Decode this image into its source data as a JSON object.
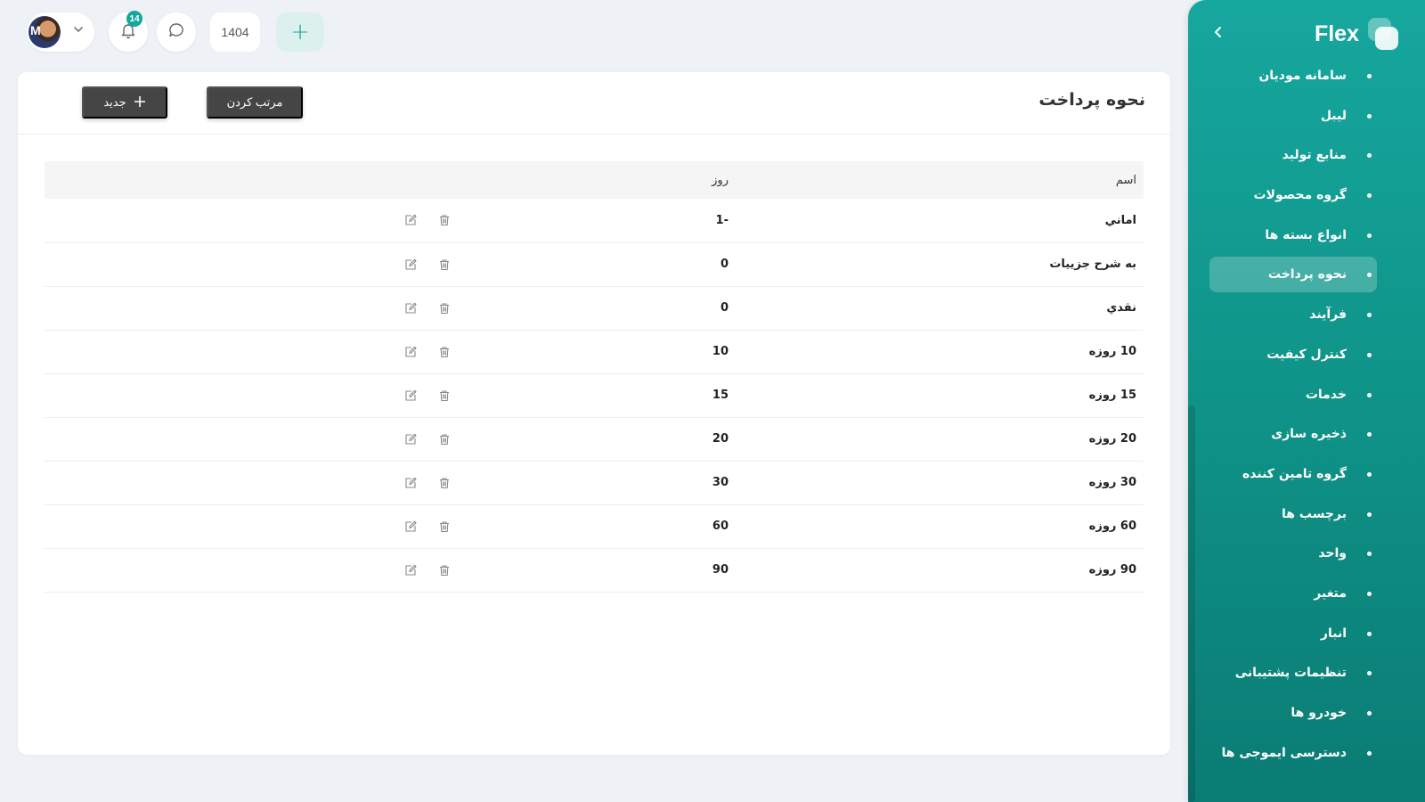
{
  "sidebar": {
    "brand": "Flex",
    "items": [
      {
        "label": "سامانه مودیان"
      },
      {
        "label": "لیبل"
      },
      {
        "label": "منابع تولید"
      },
      {
        "label": "گروه محصولات"
      },
      {
        "label": "انواع بسته ها"
      },
      {
        "label": "نحوه پرداخت",
        "active": true
      },
      {
        "label": "فرآیند"
      },
      {
        "label": "کنترل کیفیت"
      },
      {
        "label": "خدمات"
      },
      {
        "label": "ذخیره سازی"
      },
      {
        "label": "گروه تامین کننده"
      },
      {
        "label": "برچسب ها"
      },
      {
        "label": "واحد"
      },
      {
        "label": "متغیر"
      },
      {
        "label": "انبار"
      },
      {
        "label": "تنظیمات پشتیبانی"
      },
      {
        "label": "خودرو ها"
      },
      {
        "label": "دسترسی ایموجی ها"
      }
    ]
  },
  "topbar": {
    "avatar_initial": "M",
    "notification_count": "14",
    "year": "1404",
    "add_symbol": "+"
  },
  "main": {
    "title": "نحوه پرداخت",
    "sort_button": "مرتب کردن",
    "new_button": "جدید",
    "table": {
      "columns": [
        "اسم",
        "روز"
      ],
      "rows": [
        {
          "name": "اماني",
          "days": "-1"
        },
        {
          "name": "به شرح جزییات",
          "days": "0"
        },
        {
          "name": "نقدي",
          "days": "0"
        },
        {
          "name": "10 روزه",
          "days": "10"
        },
        {
          "name": "15 روزه",
          "days": "15"
        },
        {
          "name": "20 روزه",
          "days": "20"
        },
        {
          "name": "30 روزه",
          "days": "30"
        },
        {
          "name": "60 روزه",
          "days": "60"
        },
        {
          "name": "90 روزه",
          "days": "90"
        }
      ]
    }
  },
  "colors": {
    "accent": "#17a69c",
    "sidebar_top": "#16a79e",
    "sidebar_bottom": "#0a7c74",
    "button_dark": "#454545"
  }
}
